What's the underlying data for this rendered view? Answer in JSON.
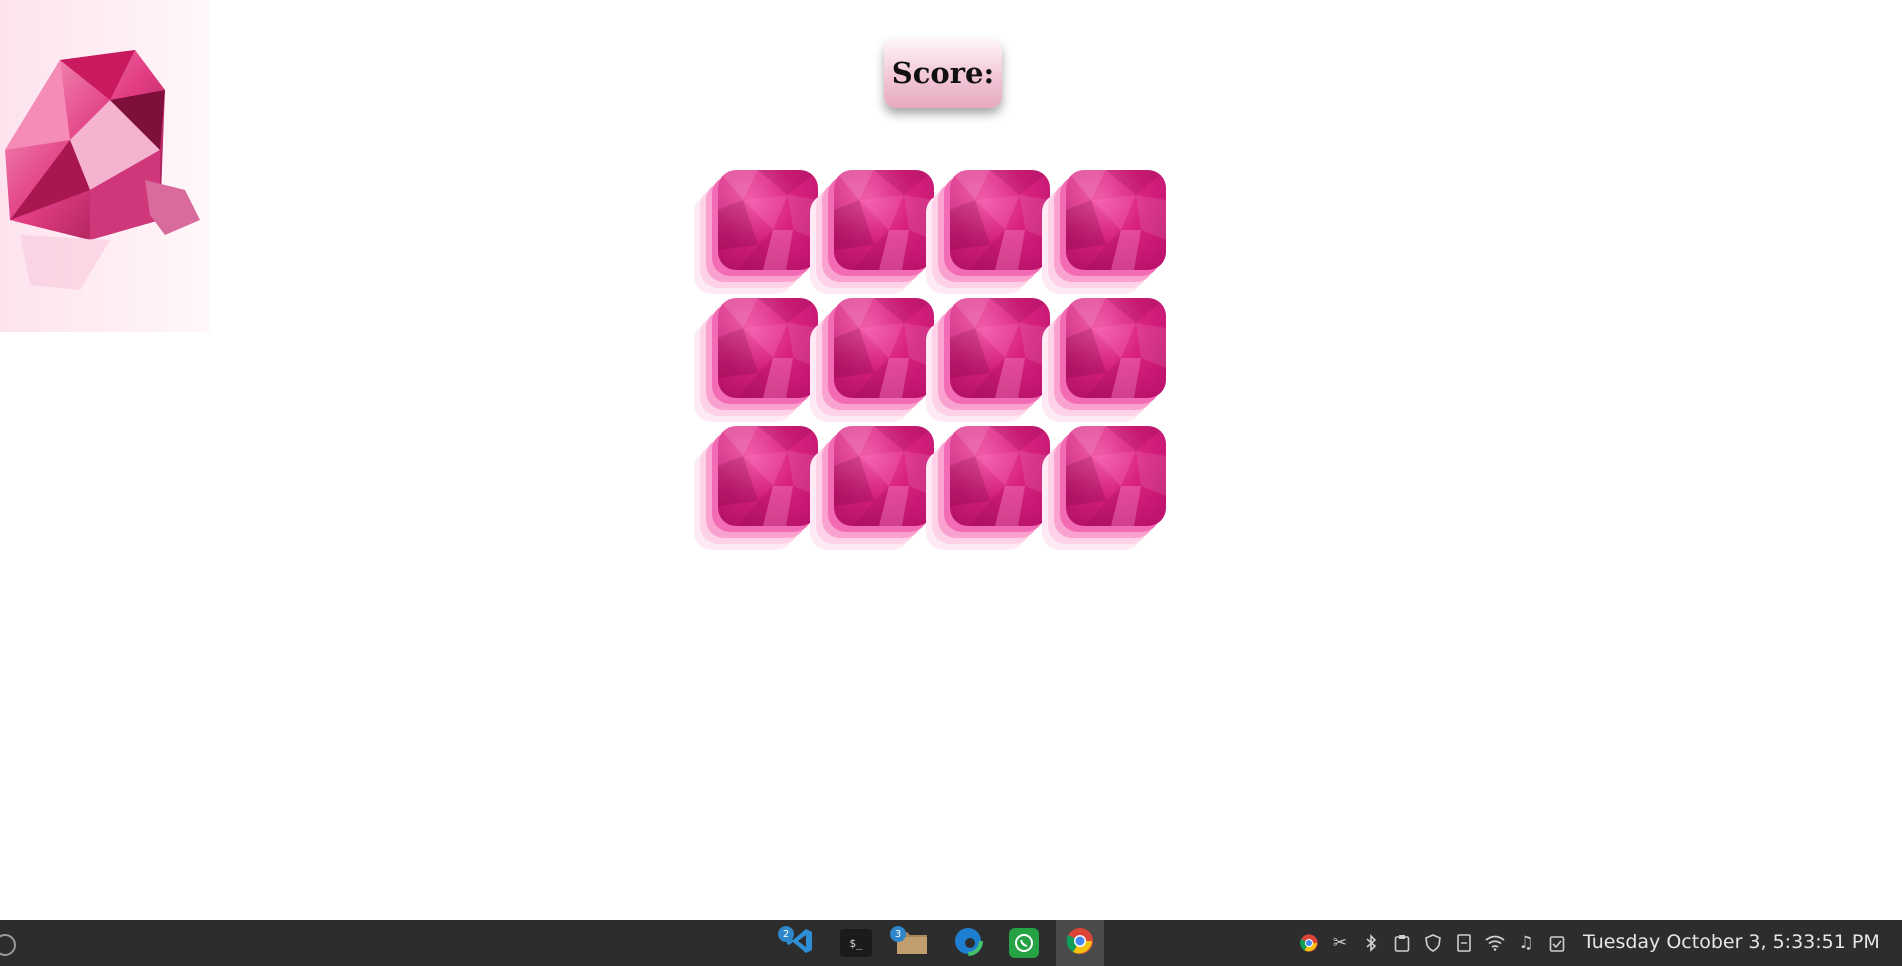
{
  "game": {
    "score_label": "Score:",
    "cards": [
      {
        "id": 1,
        "state": "face-down"
      },
      {
        "id": 2,
        "state": "face-down"
      },
      {
        "id": 3,
        "state": "face-down"
      },
      {
        "id": 4,
        "state": "face-down"
      },
      {
        "id": 5,
        "state": "face-down"
      },
      {
        "id": 6,
        "state": "face-down"
      },
      {
        "id": 7,
        "state": "face-down"
      },
      {
        "id": 8,
        "state": "face-down"
      },
      {
        "id": 9,
        "state": "face-down"
      },
      {
        "id": 10,
        "state": "face-down"
      },
      {
        "id": 11,
        "state": "face-down"
      },
      {
        "id": 12,
        "state": "face-down"
      }
    ],
    "card_color": "#d8217f"
  },
  "taskbar": {
    "apps": [
      {
        "name": "vscode-icon",
        "badge": "2"
      },
      {
        "name": "terminal-icon",
        "badge": "",
        "glyph": "$_"
      },
      {
        "name": "files-icon",
        "badge": "3"
      },
      {
        "name": "edge-icon",
        "badge": ""
      },
      {
        "name": "whatsapp-icon",
        "badge": ""
      },
      {
        "name": "chrome-icon",
        "badge": "",
        "active": true
      }
    ],
    "tray_icons": [
      "chrome-icon",
      "scissors-icon",
      "bluetooth-icon",
      "clipboard-icon",
      "shield-icon",
      "document-icon",
      "wifi-icon",
      "music-icon",
      "clipboard-check-icon"
    ],
    "clock": "Tuesday October  3,  5:33:51 PM"
  }
}
